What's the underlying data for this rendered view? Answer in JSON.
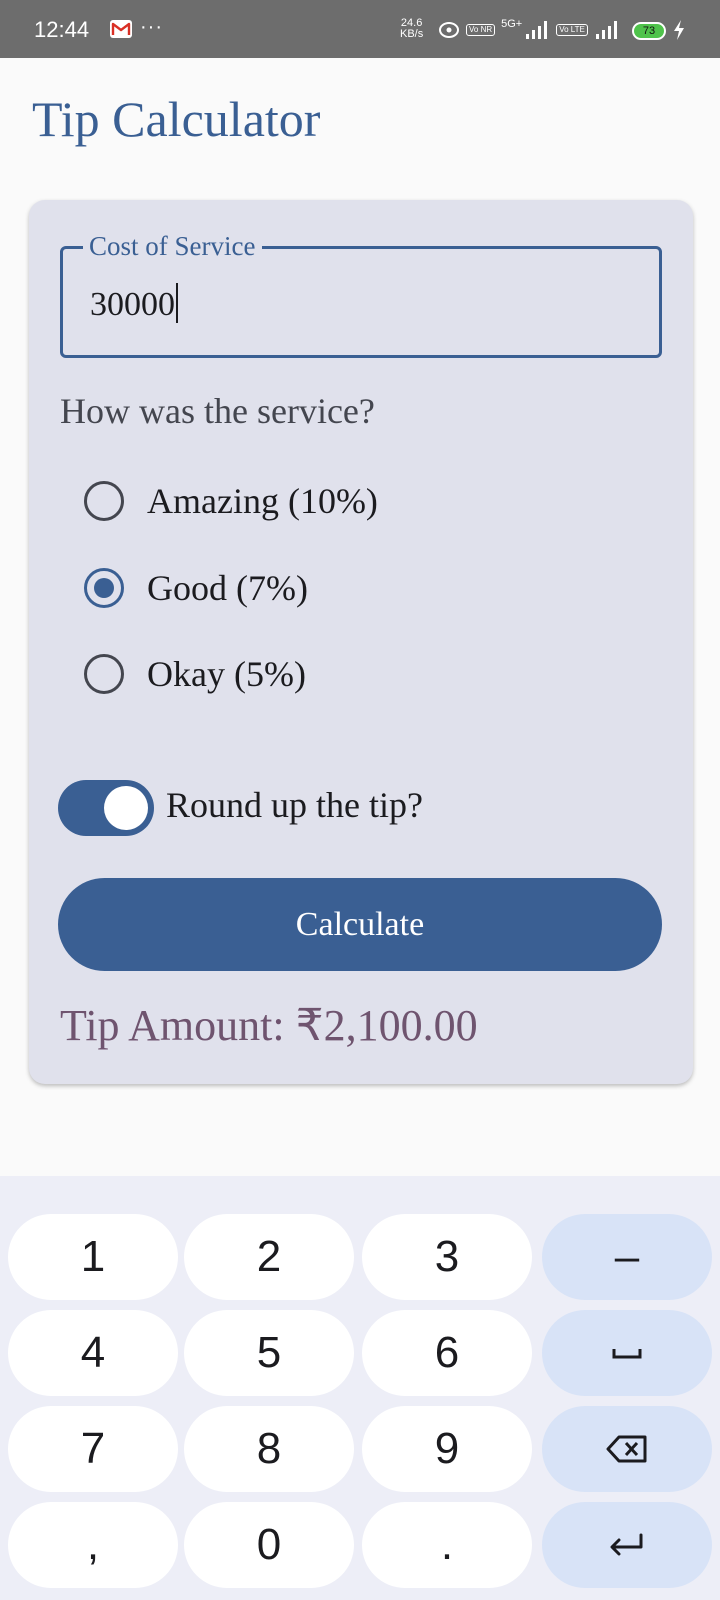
{
  "status_bar": {
    "time": "12:44",
    "dots": "···",
    "net_speed_value": "24.6",
    "net_speed_unit": "KB/s",
    "sim1_badge": "Vo NR",
    "sim1_tech": "5G+",
    "sim2_badge": "Vo LTE",
    "battery_level": "73",
    "icons": [
      "gmail-icon",
      "hotspot-icon",
      "signal-icon",
      "battery-icon",
      "charging-bolt-icon"
    ]
  },
  "app": {
    "title": "Tip Calculator",
    "cost_field": {
      "label": "Cost of Service",
      "value": "30000"
    },
    "question": "How was the service?",
    "options": [
      {
        "label": "Amazing (10%)",
        "selected": false
      },
      {
        "label": "Good (7%)",
        "selected": true
      },
      {
        "label": "Okay (5%)",
        "selected": false
      }
    ],
    "round_up": {
      "label": "Round up the tip?",
      "on": true
    },
    "calculate_label": "Calculate",
    "tip_result": "Tip Amount: ₹2,100.00"
  },
  "keyboard": {
    "keys": [
      "1",
      "2",
      "3",
      "–",
      "4",
      "5",
      "6",
      "space",
      "7",
      "8",
      "9",
      "backspace",
      ",",
      "0",
      ".",
      "enter"
    ],
    "labels": {
      "k1": "1",
      "k2": "2",
      "k3": "3",
      "dash": "–",
      "k4": "4",
      "k5": "5",
      "k6": "6",
      "k7": "7",
      "k8": "8",
      "k9": "9",
      "comma": ",",
      "k0": "0",
      "period": "."
    }
  },
  "colors": {
    "primary": "#3a5f93",
    "card": "#e0e1ec",
    "result_text": "#6f546f",
    "keyboard_bg": "#edeef7",
    "fn_key": "#d8e3f7",
    "status_bar": "#6d6d6d"
  }
}
